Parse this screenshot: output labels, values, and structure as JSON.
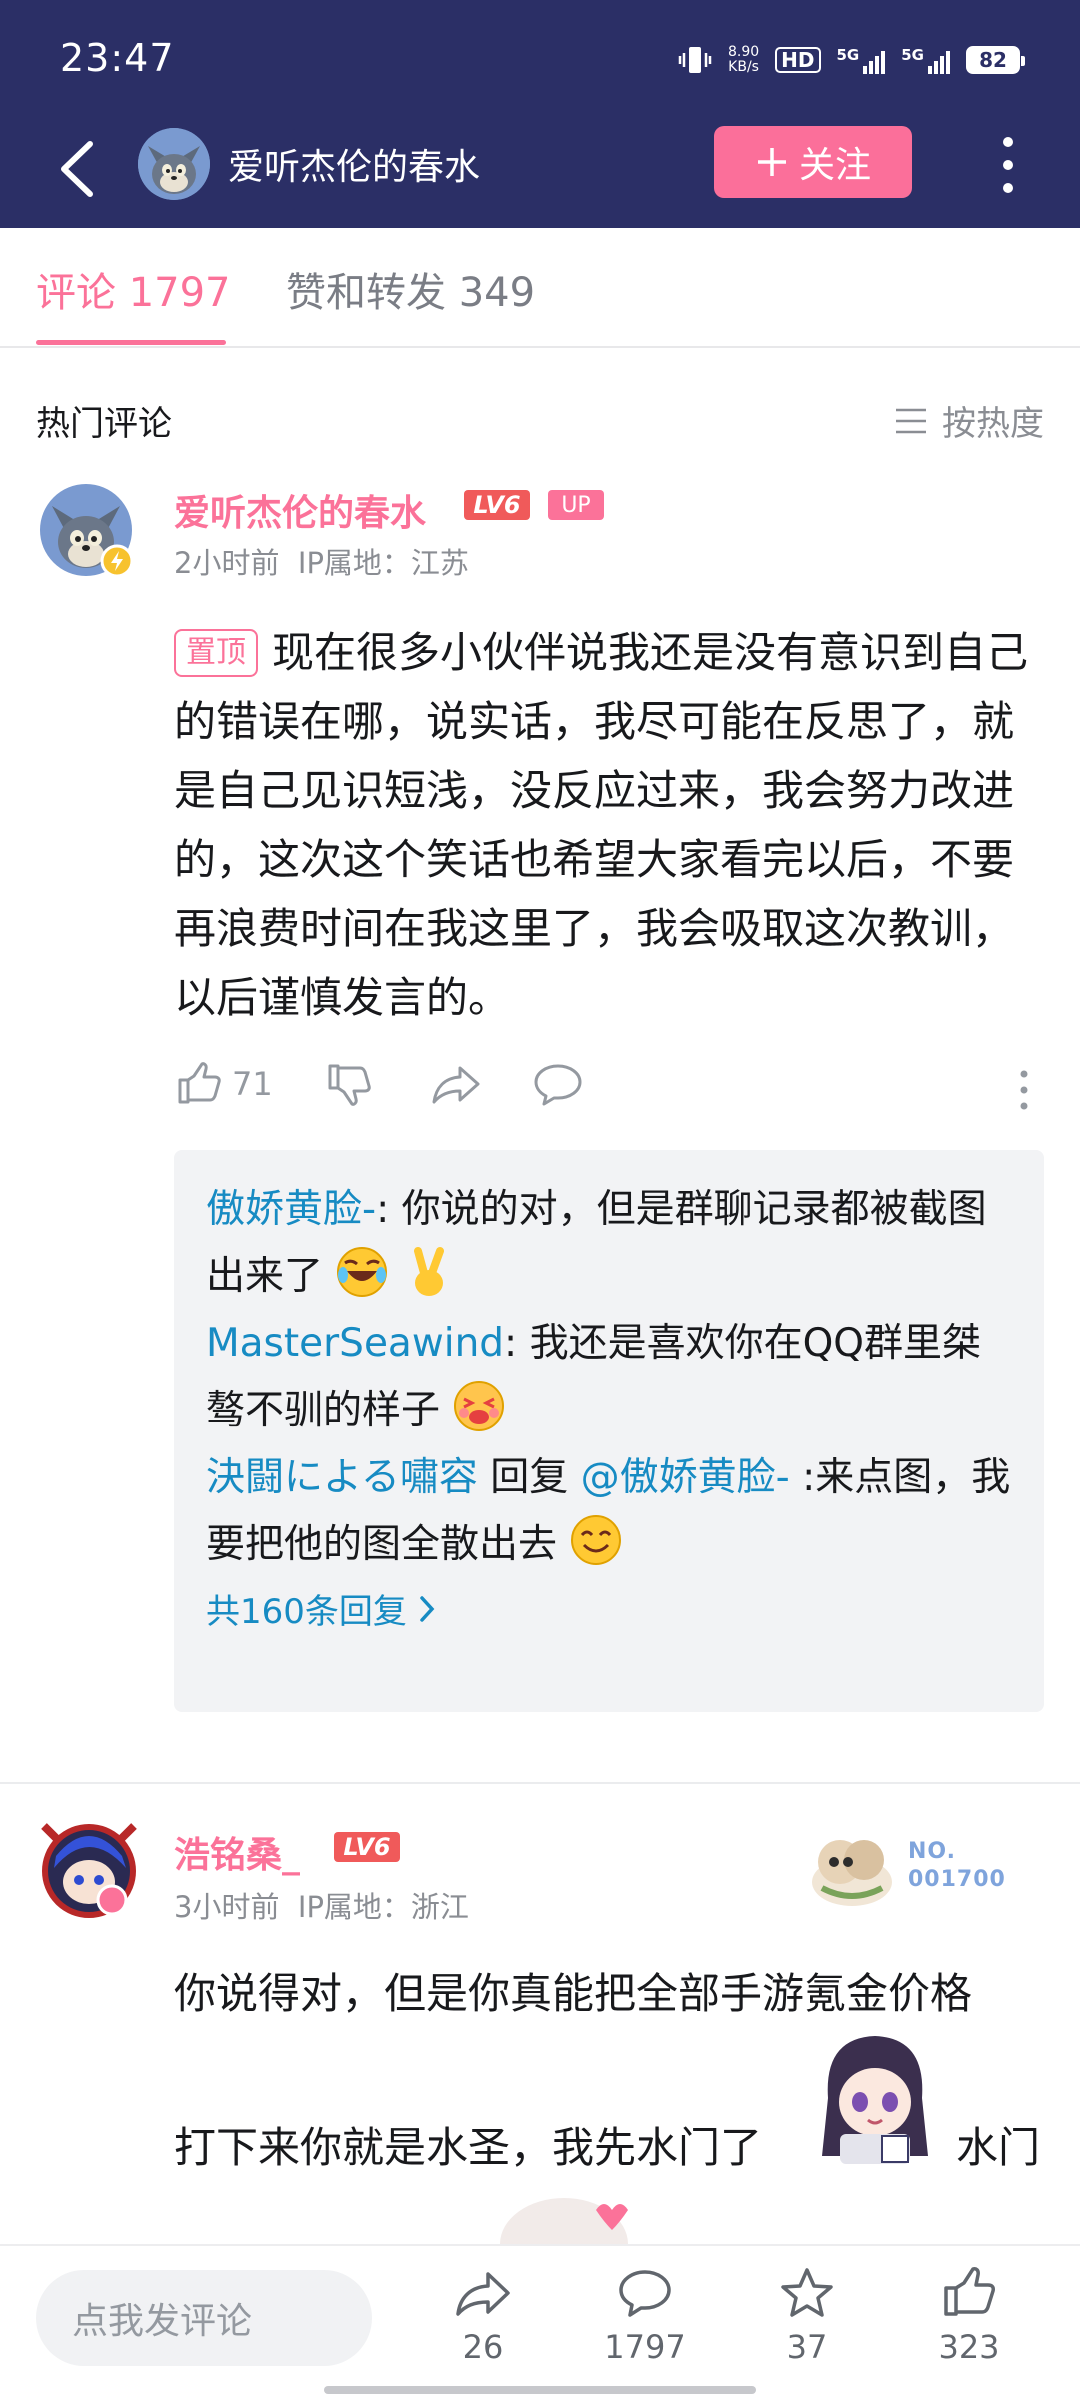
{
  "status": {
    "time": "23:47",
    "net_speed_value": "8.90",
    "net_speed_unit": "KB/s",
    "hd": "HD",
    "sim1_label": "5G",
    "sim2_label": "5G",
    "battery": "82"
  },
  "nav": {
    "title": "爱听杰伦的春水",
    "follow_label": "关注"
  },
  "tabs": [
    {
      "label": "评论 1797",
      "active": true
    },
    {
      "label": "赞和转发 349",
      "active": false
    }
  ],
  "section": {
    "title": "热门评论",
    "sort_label": "按热度"
  },
  "comments": [
    {
      "username": "爱听杰伦的春水",
      "level": "LV6",
      "up_badge": "UP",
      "time": "2小时前",
      "ip": "IP属地：江苏",
      "pin_label": "置顶",
      "text": "现在很多小伙伴说我还是没有意识到自己的错误在哪，说实话，我尽可能在反思了，就是自己见识短浅，没反应过来，我会努力改进的，这次这个笑话也希望大家看完以后，不要再浪费时间在我这里了，我会吸取这次教训，以后谨慎发言的。",
      "likes": "71",
      "replies": [
        {
          "name": "傲娇黄脸-",
          "text": ": 你说的对，但是群聊记录都被截图出来了"
        },
        {
          "name": "MasterSeawind",
          "text": ": 我还是喜欢你在QQ群里桀骜不驯的样子"
        },
        {
          "name": "決闘による嘯容",
          "reply_word": " 回复 ",
          "reply_to": "@傲娇黄脸-",
          "text": " :来点图，我要把他的图全散出去"
        }
      ],
      "more_replies": "共160条回复"
    },
    {
      "username": "浩铭桑_",
      "level": "LV6",
      "time": "3小时前",
      "ip": "IP属地：浙江",
      "fan_no_label": "NO.",
      "fan_no": "001700",
      "text_line1": "你说得对，但是你真能把全部手游氪金价格",
      "text_line2": "打下来你就是水圣，我先水门了",
      "text_tail": "水门"
    }
  ],
  "bottom": {
    "input_placeholder": "点我发评论",
    "share_count": "26",
    "comment_count": "1797",
    "fav_count": "37",
    "like_count": "323"
  },
  "colors": {
    "header_bg": "#2b2f66",
    "accent_pink": "#fb7299",
    "link_blue": "#178bc3",
    "level_red": "#f05a5a"
  }
}
